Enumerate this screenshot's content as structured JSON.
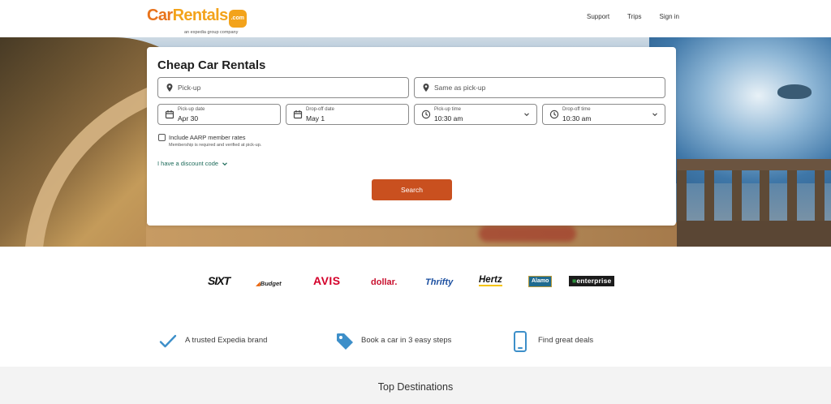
{
  "header": {
    "logo": {
      "part1": "Car",
      "part2": "Rentals",
      "dotcom": ".com",
      "subtitle": "an expedia group company"
    },
    "nav": [
      "Support",
      "Trips",
      "Sign in"
    ]
  },
  "search": {
    "title": "Cheap Car Rentals",
    "pickup": {
      "placeholder": "Pick-up"
    },
    "dropoff": {
      "placeholder": "Same as pick-up"
    },
    "pickup_date": {
      "label": "Pick-up date",
      "value": "Apr 30"
    },
    "dropoff_date": {
      "label": "Drop-off date",
      "value": "May 1"
    },
    "pickup_time": {
      "label": "Pick-up time",
      "value": "10:30 am"
    },
    "dropoff_time": {
      "label": "Drop-off time",
      "value": "10:30 am"
    },
    "aarp": {
      "label": "Include AARP member rates",
      "note": "Membership is required and verified at pick-up."
    },
    "discount_link": "I have a discount code",
    "button": "Search",
    "button_color": "#c9501f"
  },
  "brands": [
    "SIXT",
    "Budget",
    "AVIS",
    "dollar.",
    "Thrifty",
    "Hertz",
    "Alamo",
    "enterprise"
  ],
  "features": [
    {
      "icon": "checkmark-icon",
      "text": "A trusted Expedia brand"
    },
    {
      "icon": "tag-icon",
      "text": "Book a car in 3 easy steps"
    },
    {
      "icon": "phone-icon",
      "text": "Find great deals"
    }
  ],
  "top_destinations": {
    "title": "Top Destinations"
  }
}
